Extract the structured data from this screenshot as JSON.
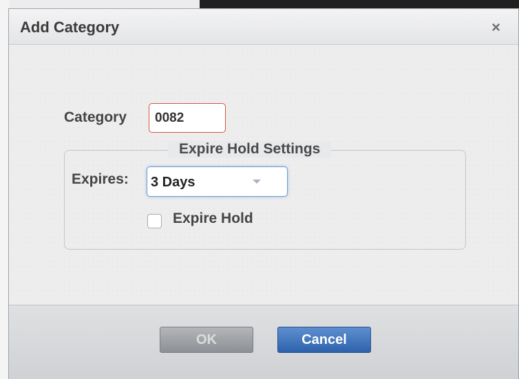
{
  "dialog": {
    "title": "Add Category",
    "close_glyph": "×"
  },
  "form": {
    "category_label": "Category",
    "category_value": "0082",
    "fieldset_legend": "Expire Hold Settings",
    "expires_label": "Expires:",
    "expires_value": "3 Days",
    "expire_hold_label": "Expire Hold",
    "expire_hold_checked": false
  },
  "footer": {
    "ok_label": "OK",
    "cancel_label": "Cancel"
  },
  "icons": {
    "close": "close-icon",
    "dropdown": "chevron-down-icon"
  },
  "colors": {
    "accent_blue": "#3a6fb8",
    "error_border": "#d2553f"
  }
}
